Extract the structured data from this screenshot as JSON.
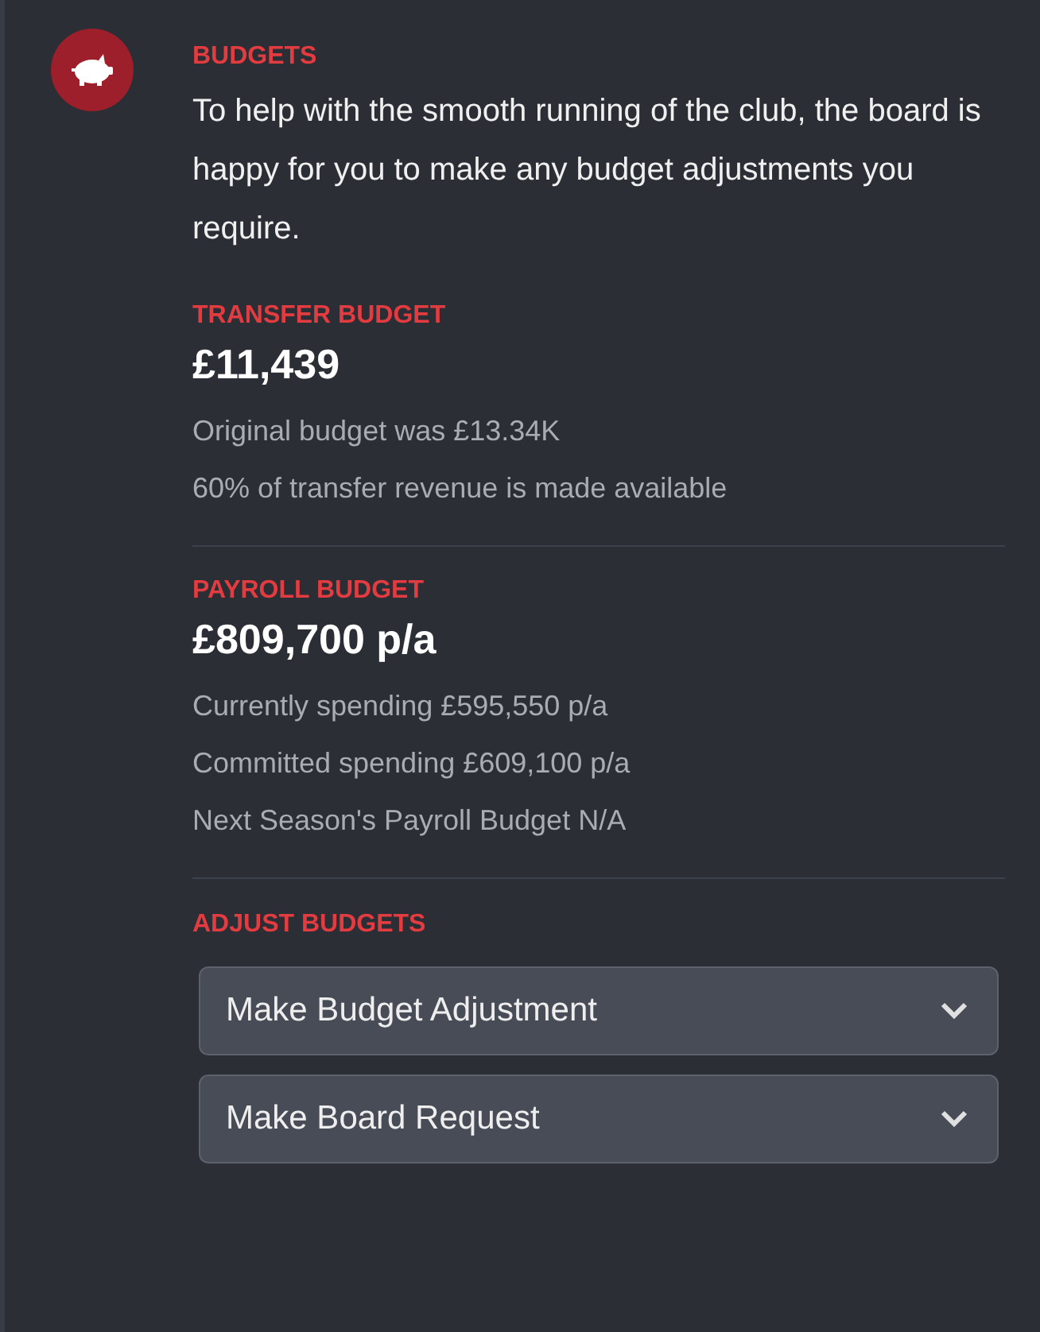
{
  "header": {
    "title": "BUDGETS",
    "description": "To help with the smooth running of the club, the board is happy for you to make any budget adjustments you require."
  },
  "sections": [
    {
      "title": "TRANSFER BUDGET",
      "amount": "£11,439",
      "notes": [
        "Original budget was £13.34K",
        "60% of transfer revenue is made available"
      ]
    },
    {
      "title": "PAYROLL BUDGET",
      "amount": "£809,700 p/a",
      "notes": [
        "Currently spending £595,550 p/a",
        "Committed spending £609,100 p/a",
        "Next Season's Payroll Budget N/A"
      ]
    }
  ],
  "adjust": {
    "title": "ADJUST BUDGETS",
    "dropdowns": [
      {
        "label": "Make Budget Adjustment"
      },
      {
        "label": "Make Board Request"
      }
    ]
  }
}
